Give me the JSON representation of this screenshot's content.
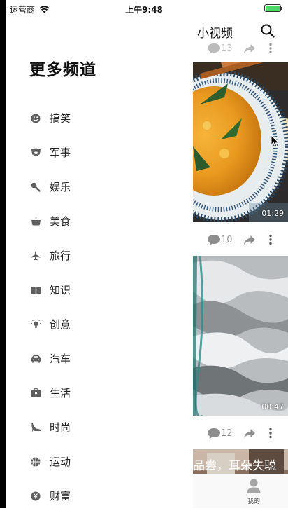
{
  "status": {
    "carrier": "运营商",
    "time": "上午9:48",
    "battery_percent": 100
  },
  "drawer": {
    "title": "更多频道",
    "channels": [
      {
        "label": "搞笑",
        "icon": "smiley-icon"
      },
      {
        "label": "军事",
        "icon": "military-badge-icon"
      },
      {
        "label": "娱乐",
        "icon": "microphone-icon"
      },
      {
        "label": "美食",
        "icon": "food-bowl-icon"
      },
      {
        "label": "旅行",
        "icon": "airplane-icon"
      },
      {
        "label": "知识",
        "icon": "book-icon"
      },
      {
        "label": "创意",
        "icon": "lightbulb-icon"
      },
      {
        "label": "汽车",
        "icon": "car-icon"
      },
      {
        "label": "生活",
        "icon": "briefcase-icon"
      },
      {
        "label": "时尚",
        "icon": "high-heel-icon"
      },
      {
        "label": "运动",
        "icon": "basketball-icon"
      },
      {
        "label": "财富",
        "icon": "coin-icon"
      }
    ]
  },
  "feed": {
    "title": "小视频",
    "top_partial_comment_count": "13",
    "cards": [
      {
        "duration": "01:29",
        "comments": "10"
      },
      {
        "duration": "00:47",
        "comments": "12"
      }
    ],
    "bottom_caption": "品尝，耳朵失聪"
  },
  "tabbar": {
    "me_label": "我的"
  },
  "colors": {
    "icon_gray": "#5f5f5f",
    "action_gray": "#8e8e8e",
    "battery_green": "#4cd964"
  }
}
